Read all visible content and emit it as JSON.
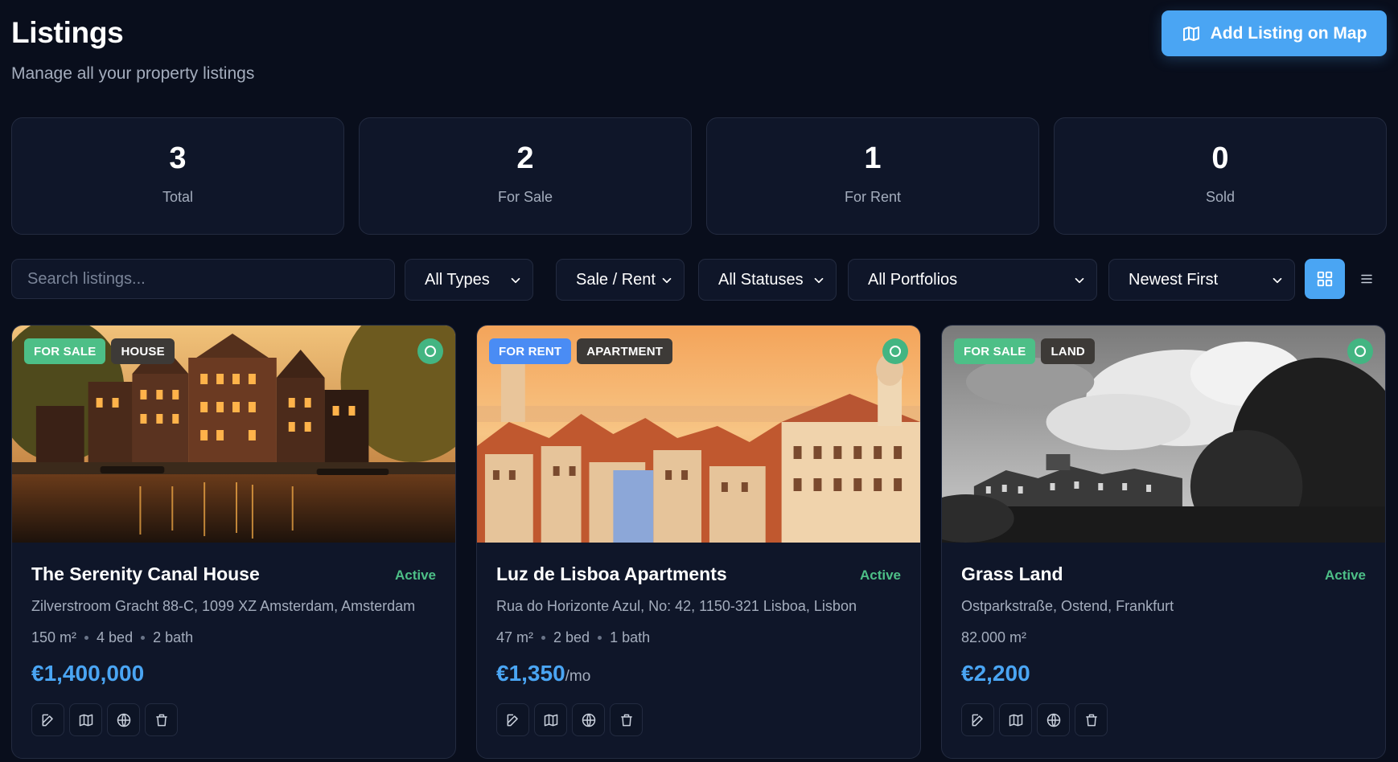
{
  "header": {
    "title": "Listings",
    "subtitle": "Manage all your property listings",
    "add_button_label": "Add Listing on Map",
    "add_button_icon": "map-icon"
  },
  "stats": [
    {
      "value": "3",
      "label": "Total"
    },
    {
      "value": "2",
      "label": "For Sale"
    },
    {
      "value": "1",
      "label": "For Rent"
    },
    {
      "value": "0",
      "label": "Sold"
    }
  ],
  "filters": {
    "search_placeholder": "Search listings...",
    "search_value": "",
    "type": "All Types",
    "mode": "Sale / Rent",
    "status": "All Statuses",
    "portfolio": "All Portfolios",
    "sort": "Newest First",
    "view_mode": "grid"
  },
  "listings": [
    {
      "deal": "FOR SALE",
      "type": "HOUSE",
      "title": "The Serenity Canal House",
      "status": "Active",
      "address": "Zilverstroom Gracht 88-C, 1099 XZ Amsterdam, Amsterdam",
      "area": "150 m²",
      "beds": "4 bed",
      "baths": "2 bath",
      "price": "€1,400,000",
      "price_unit": ""
    },
    {
      "deal": "FOR RENT",
      "type": "APARTMENT",
      "title": "Luz de Lisboa Apartments",
      "status": "Active",
      "address": "Rua do Horizonte Azul, No: 42, 1150-321 Lisboa, Lisbon",
      "area": "47 m²",
      "beds": "2 bed",
      "baths": "1 bath",
      "price": "€1,350",
      "price_unit": "/mo"
    },
    {
      "deal": "FOR SALE",
      "type": "LAND",
      "title": "Grass Land",
      "status": "Active",
      "address": "Ostparkstraße, Ostend, Frankfurt",
      "area": "82.000 m²",
      "beds": "",
      "baths": "",
      "price": "€2,200",
      "price_unit": ""
    }
  ],
  "colors": {
    "background": "#090e1c",
    "card": "#0f1629",
    "accent": "#4aa5f3",
    "sale_badge": "#4dbf87",
    "rent_badge": "#4a8cf4",
    "active_text": "#4dbf87"
  },
  "icons": {
    "card_actions": [
      "edit-icon",
      "map-icon",
      "globe-icon",
      "trash-icon"
    ],
    "view_grid": "grid-icon",
    "view_list": "list-icon"
  }
}
